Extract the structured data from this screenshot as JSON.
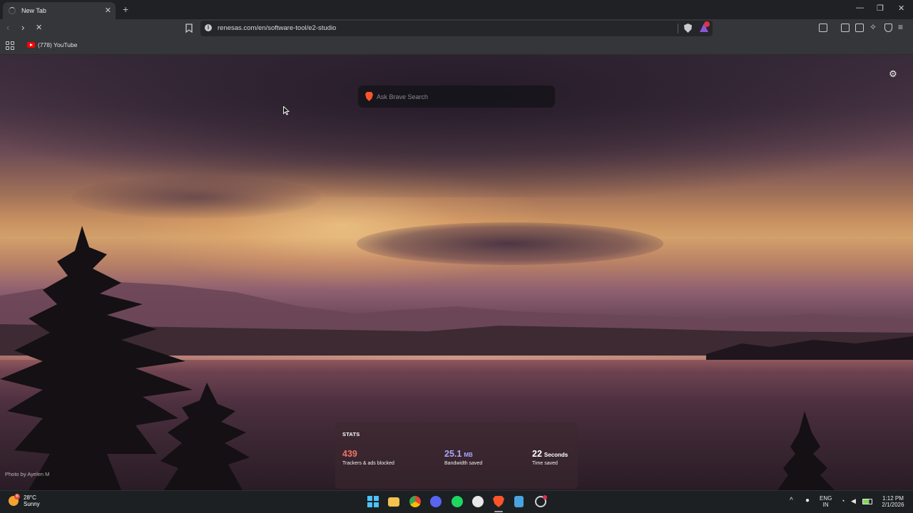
{
  "browser": {
    "tab": {
      "title": "New Tab",
      "close_icon": "close-icon"
    },
    "toolbar": {
      "url": "renesas.com/en/software-tool/e2-studio",
      "back_icon": "back-arrow-icon",
      "forward_icon": "forward-arrow-icon",
      "stop_icon": "stop-loading-icon"
    },
    "bookmarks": {
      "items": [
        {
          "label": "(778) YouTube",
          "icon": "youtube-icon"
        }
      ]
    }
  },
  "newtab": {
    "search": {
      "placeholder": "Ask Brave Search"
    },
    "stats": {
      "heading": "STATS",
      "items": [
        {
          "value": "439",
          "unit": "",
          "label": "Trackers & ads blocked",
          "color": "#f0746a"
        },
        {
          "value": "25.1",
          "unit": "MB",
          "label": "Bandwidth saved",
          "color": "#a9a7ff"
        },
        {
          "value": "22",
          "unit": "Seconds",
          "label": "Time saved",
          "color": "#ffffff"
        }
      ]
    },
    "photo_credit": "Photo by Ayelen M"
  },
  "taskbar": {
    "weather": {
      "temp": "28°C",
      "condition": "Sunny",
      "badge": "6"
    },
    "apps": [
      "windows-start-icon",
      "file-explorer-icon",
      "chrome-icon",
      "discord-icon",
      "spotify-icon",
      "github-icon",
      "brave-icon",
      "notepad-icon",
      "settings-icon"
    ],
    "tray": {
      "lang_line1": "ENG",
      "lang_line2": "IN",
      "time": "1:12 PM",
      "date": "2/1/2026"
    }
  },
  "colors": {
    "accent_brave": "#fb542b",
    "stat_trackers": "#f0746a",
    "stat_bandwidth": "#a9a7ff"
  }
}
